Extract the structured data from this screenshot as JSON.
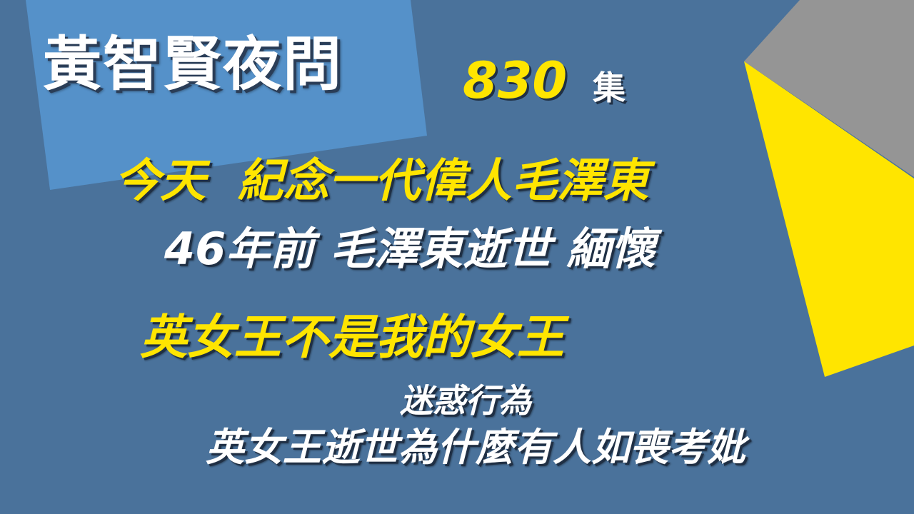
{
  "title": {
    "show_name": "黃智賢夜問",
    "episode_number": "830",
    "episode_suffix": "集"
  },
  "headlines": [
    "今天  紀念一代偉人毛澤東",
    "46年前 毛澤東逝世 緬懷",
    "英女王不是我的女王",
    "迷惑行為",
    "英女王逝世為什麼有人如喪考妣"
  ],
  "colors": {
    "background": "#4a729b",
    "panel": "#5591c9",
    "accent_yellow": "#ffe500",
    "accent_gray": "#959595",
    "text_white": "#ffffff"
  }
}
